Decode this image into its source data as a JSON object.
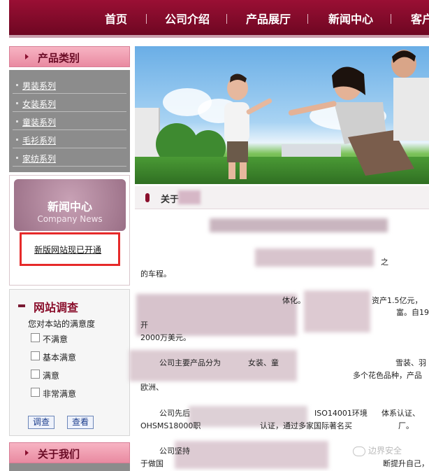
{
  "nav": {
    "items": [
      "首页",
      "公司介绍",
      "产品展厅",
      "新闻中心",
      "客户"
    ]
  },
  "sidebar": {
    "product_title": "产品类别",
    "categories": [
      "男装系列",
      "女装系列",
      "童装系列",
      "毛衫系列",
      "家纺系列"
    ],
    "news_banner_cn": "新闻中心",
    "news_banner_en": "Company News",
    "news_link": "新版网站现已开通",
    "survey": {
      "title": "网站调查",
      "question": "您对本站的满意度",
      "options": [
        "不满意",
        "基本满意",
        "满意",
        "非常满意"
      ],
      "submit": "调查",
      "view": "查看"
    },
    "about_title": "关于我们"
  },
  "content": {
    "header_title": "关于",
    "lines": [
      "之",
      "的车程。",
      "体化。",
      "资产1.5亿元，",
      "开",
      "富。自19",
      "2000万美元。",
      "公司主要产品分为",
      "女装、童",
      "雪装、羽",
      "欧洲、",
      "多个花色品种，产品",
      "公司先后",
      "ISO14001环境",
      "体系认证、",
      "OHSMS18000职",
      "认证，通过多家国际著名买",
      "厂。",
      "公司坚持",
      "于做国",
      "断提升自己，成"
    ]
  },
  "watermark": "边界安全"
}
